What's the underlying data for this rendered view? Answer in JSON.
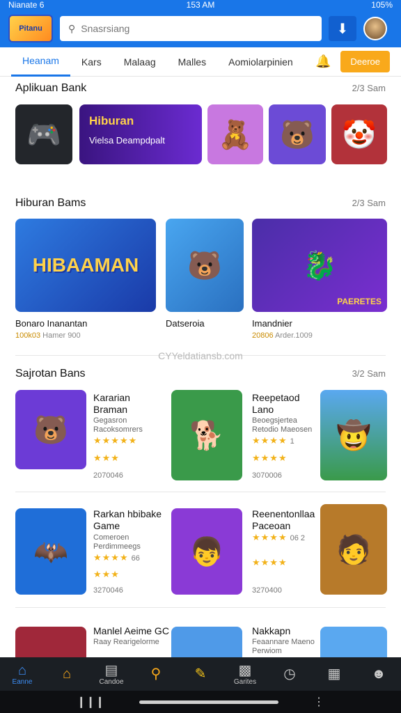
{
  "status": {
    "left": "Nianate 6",
    "time": "153 AM",
    "right": "105%"
  },
  "header": {
    "logo_text": "Pitanu",
    "search_placeholder": "Snasrsiang"
  },
  "tabs": [
    {
      "label": "Heanam"
    },
    {
      "label": "Kars"
    },
    {
      "label": "Malaag"
    },
    {
      "label": "Malles"
    },
    {
      "label": "Aomiolarpinien"
    }
  ],
  "cta_label": "Deeroe",
  "section1": {
    "title": "Aplikuan Bank",
    "more": "2/3 Sam",
    "tiles": [
      {
        "icon": "game-logo-icon",
        "bg": "#23262b"
      },
      {
        "icon": "bear-icon",
        "bg": "#c878e0"
      },
      {
        "icon": "bear-icon",
        "bg": "#6c4bd6"
      },
      {
        "icon": "clown-icon",
        "bg": "#b2323a"
      }
    ],
    "banner": {
      "title": "Hiburan",
      "subtitle": "Vielsa Deampdpalt"
    }
  },
  "section2": {
    "title": "Hiburan Bams",
    "more": "2/3 Sam",
    "items": [
      {
        "title": "Bonaro Inanantan",
        "badge": "100k03",
        "meta": "Hamer 900",
        "art": "HIBAAMAN",
        "bg": "#2e7be0"
      },
      {
        "title": "Datseroia",
        "badge": "",
        "meta": "",
        "art": "",
        "bg": "#49a6f0"
      },
      {
        "title": "Imandnier",
        "badge": "20806",
        "meta": "Arder.1009",
        "art": "PAERETES",
        "bg": "#4a2ea8"
      }
    ]
  },
  "watermark": "CYYeldatiansb.com",
  "section3": {
    "title": "Sajrotan Bans",
    "more": "3/2 Sam",
    "cards": [
      {
        "title": "Kararian Braman",
        "sub": "Gegasron Racoksomrers",
        "stars": "★★★★★",
        "stars2": "★★★",
        "rate": "",
        "count": "2070046",
        "bg": "#6c3bd6"
      },
      {
        "title": "Reepetaod Lano",
        "sub": "Beoegsjertea Retodio Maeosen",
        "stars": "★★★★",
        "stars2": "★★★★",
        "rate": "1",
        "count": "3070006",
        "bg": "#3a9a4a"
      },
      {
        "title": "Rarkan hbibake Game",
        "sub": "Comeroen Perdimmeegs",
        "stars": "★★★★",
        "stars2": "★★★",
        "rate": "66",
        "count": "3270046",
        "bg": "#1f6ed8"
      },
      {
        "title": "Reenentonllaa Paceoan",
        "sub": "",
        "stars": "★★★★",
        "stars2": "★★★★",
        "rate": "06 2",
        "count": "3270400",
        "bg": "#b77a2a"
      },
      {
        "title": "Manlel Aeime GC",
        "sub": "Raay Rearigelorme",
        "stars": "",
        "stars2": "",
        "rate": "",
        "count": "",
        "bg": "#a0283a"
      },
      {
        "title": "Nakkapn",
        "sub": "Feaannare Maeno Perwiom",
        "stars": "",
        "stars2": "",
        "rate": "",
        "count": "",
        "bg": "#4f9ae8"
      }
    ]
  },
  "bottom_nav": [
    {
      "label": "Eanne",
      "icon": "home-icon"
    },
    {
      "label": "",
      "icon": "house-icon"
    },
    {
      "label": "Candoe",
      "icon": "folder-icon"
    },
    {
      "label": "",
      "icon": "search-icon"
    },
    {
      "label": "",
      "icon": "chat-icon"
    },
    {
      "label": "Garites",
      "icon": "box-icon"
    },
    {
      "label": "",
      "icon": "clock-icon"
    },
    {
      "label": "",
      "icon": "gamepad-icon"
    },
    {
      "label": "",
      "icon": "person-icon"
    }
  ],
  "theme": {
    "primary": "#1976e8",
    "accent": "#f9a91b",
    "star": "#f2b21a"
  }
}
